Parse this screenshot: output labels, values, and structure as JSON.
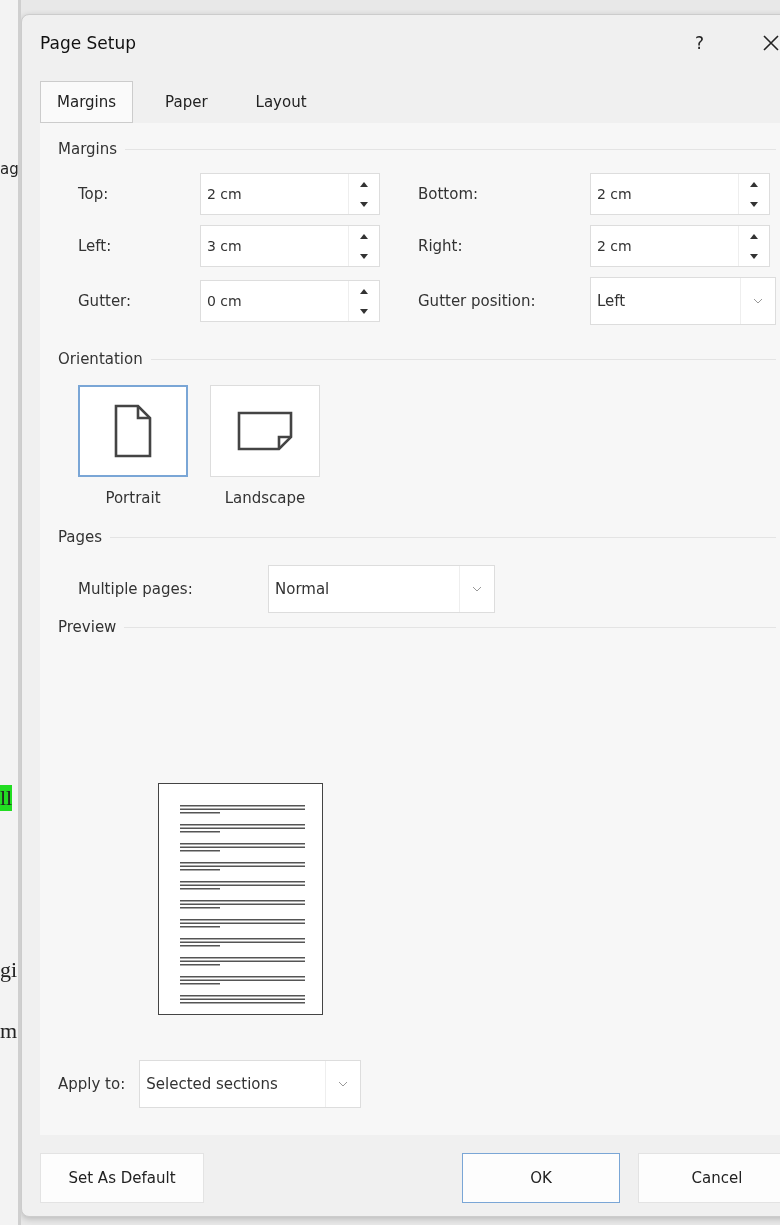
{
  "background_fragments": [
    "ag",
    "ll",
    "gi",
    "m"
  ],
  "window": {
    "title": "Page Setup",
    "help": "?"
  },
  "tabs": [
    {
      "label": "Margins",
      "selected": true
    },
    {
      "label": "Paper",
      "selected": false
    },
    {
      "label": "Layout",
      "selected": false
    }
  ],
  "margins": {
    "heading": "Margins",
    "fields": [
      {
        "label": "Top:",
        "kind": "spin",
        "value": "2 cm"
      },
      {
        "label": "Bottom:",
        "kind": "spin",
        "value": "2 cm"
      },
      {
        "label": "Left:",
        "kind": "spin",
        "value": "3 cm"
      },
      {
        "label": "Right:",
        "kind": "spin",
        "value": "2 cm"
      },
      {
        "label": "Gutter:",
        "kind": "spin",
        "value": "0 cm"
      },
      {
        "label": "Gutter position:",
        "kind": "dropdown",
        "value": "Left"
      }
    ]
  },
  "orientation": {
    "heading": "Orientation",
    "options": [
      {
        "label": "Portrait",
        "kind": "portrait",
        "selected": true
      },
      {
        "label": "Landscape",
        "kind": "landscape",
        "selected": false
      }
    ]
  },
  "pages": {
    "heading": "Pages",
    "label": "Multiple pages:",
    "value": "Normal"
  },
  "preview": {
    "heading": "Preview"
  },
  "apply_to": {
    "label": "Apply to:",
    "value": "Selected sections"
  },
  "buttons": [
    {
      "label": "Set As Default",
      "kind": "left",
      "selected": false
    },
    {
      "label": "OK",
      "kind": "right",
      "selected": true
    },
    {
      "label": "Cancel",
      "kind": "right",
      "selected": false
    }
  ]
}
